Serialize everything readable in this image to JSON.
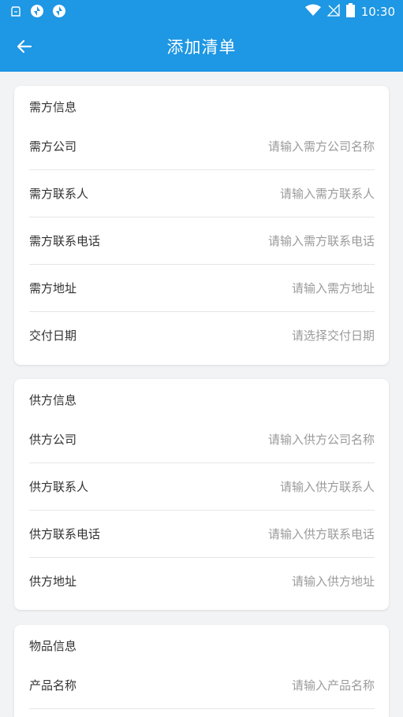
{
  "status_bar": {
    "time": "10:30",
    "icons": [
      "clipboard-icon",
      "sync-icon",
      "sync-icon",
      "wifi-icon",
      "no-signal-icon",
      "battery-icon"
    ]
  },
  "app_bar": {
    "title": "添加清单",
    "back_icon": "arrow-left-icon"
  },
  "colors": {
    "primary": "#1e97e4",
    "background": "#f2f3f5",
    "placeholder": "#9b9b9b"
  },
  "sections": [
    {
      "title": "需方信息",
      "rows": [
        {
          "label": "需方公司",
          "placeholder": "请输入需方公司名称"
        },
        {
          "label": "需方联系人",
          "placeholder": "请输入需方联系人"
        },
        {
          "label": "需方联系电话",
          "placeholder": "请输入需方联系电话"
        },
        {
          "label": "需方地址",
          "placeholder": "请输入需方地址"
        },
        {
          "label": "交付日期",
          "placeholder": "请选择交付日期"
        }
      ]
    },
    {
      "title": "供方信息",
      "rows": [
        {
          "label": "供方公司",
          "placeholder": "请输入供方公司名称"
        },
        {
          "label": "供方联系人",
          "placeholder": "请输入供方联系人"
        },
        {
          "label": "供方联系电话",
          "placeholder": "请输入供方联系电话"
        },
        {
          "label": "供方地址",
          "placeholder": "请输入供方地址"
        }
      ]
    },
    {
      "title": "物品信息",
      "rows": [
        {
          "label": "产品名称",
          "placeholder": "请输入产品名称"
        }
      ]
    }
  ]
}
